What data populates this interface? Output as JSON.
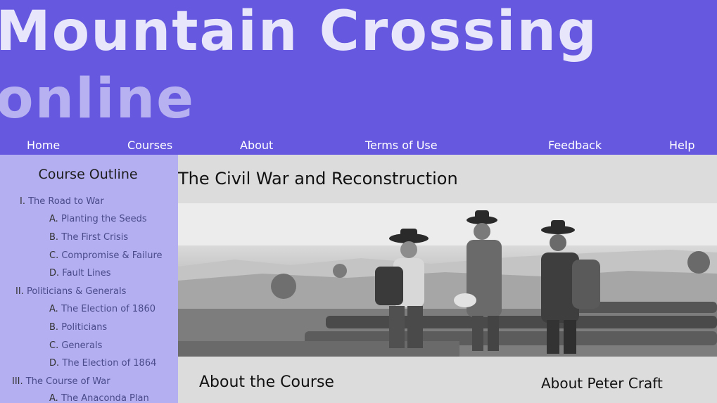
{
  "header": {
    "logo_line1": "Mountain Crossing",
    "logo_line2": "online"
  },
  "nav": {
    "items": [
      {
        "label": "Home"
      },
      {
        "label": "Courses"
      },
      {
        "label": "About"
      },
      {
        "label": "Terms of Use"
      },
      {
        "label": "Feedback"
      },
      {
        "label": "Help"
      }
    ]
  },
  "sidebar": {
    "title": "Course Outline",
    "items": [
      {
        "num": "I.",
        "label": "The Road to War"
      },
      {
        "num": "A.",
        "label": "Planting the Seeds"
      },
      {
        "num": "B.",
        "label": "The First Crisis"
      },
      {
        "num": "C.",
        "label": "Compromise & Failure"
      },
      {
        "num": "D.",
        "label": "Fault Lines"
      },
      {
        "num": "II.",
        "label": "Politicians & Generals"
      },
      {
        "num": "A.",
        "label": "The Election of 1860"
      },
      {
        "num": "B.",
        "label": "Politicians"
      },
      {
        "num": "C.",
        "label": "Generals"
      },
      {
        "num": "D.",
        "label": "The Election of 1864"
      },
      {
        "num": "III.",
        "label": "The Course of War"
      },
      {
        "num": "A.",
        "label": "The Anaconda Plan"
      }
    ]
  },
  "main": {
    "title": "The Civil War and Reconstruction",
    "about_course": "About the Course",
    "about_peter": "About Peter Craft"
  },
  "colors": {
    "header": "#6659e0",
    "sidebar": "#b3aff0",
    "content": "#dcdcdc"
  }
}
